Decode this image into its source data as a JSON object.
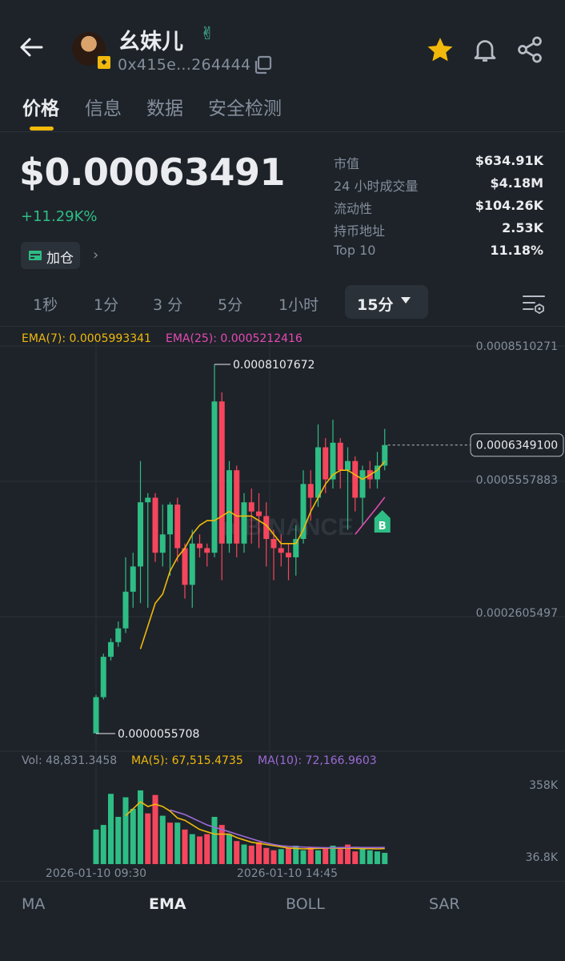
{
  "header": {
    "token_name": "幺妹儿",
    "hand_emoji": "✌",
    "address": "0x415e...264444"
  },
  "tabs": [
    {
      "label": "价格",
      "active": true
    },
    {
      "label": "信息",
      "active": false
    },
    {
      "label": "数据",
      "active": false
    },
    {
      "label": "安全检测",
      "active": false
    }
  ],
  "price": {
    "value": "$0.00063491",
    "change": "+11.29K%",
    "add_position_label": "加仓"
  },
  "stats": [
    {
      "label": "市值",
      "value": "$634.91K"
    },
    {
      "label": "24 小时成交量",
      "value": "$4.18M"
    },
    {
      "label": "流动性",
      "value": "$104.26K"
    },
    {
      "label": "持币地址",
      "value": "2.53K"
    },
    {
      "label": "Top 10",
      "value": "11.18%"
    }
  ],
  "intervals": [
    "1秒",
    "1分",
    "3 分",
    "5分",
    "1小时"
  ],
  "active_interval": "15分",
  "indicators": {
    "ema7": "EMA(7): 0.0005993341",
    "ema25": "EMA(25): 0.0005212416",
    "vol": "Vol: 48,831.3458",
    "ma5": "MA(5): 67,515.4735",
    "ma10": "MA(10): 72,166.9603"
  },
  "bottom_tabs": [
    {
      "label": "MA",
      "active": false
    },
    {
      "label": "EMA",
      "active": true
    },
    {
      "label": "BOLL",
      "active": false
    },
    {
      "label": "SAR",
      "active": false
    }
  ],
  "colors": {
    "up": "#2ebd85",
    "down": "#f6465d",
    "ema7": "#f0b90b",
    "ema25": "#e44ab5",
    "ma10": "#9c6ad6",
    "accent": "#f0b90b"
  },
  "chart_data": {
    "type": "candlestick",
    "price_axis_labels": [
      "0.0008510271",
      "0.0005557883",
      "0.0002605497"
    ],
    "current_price_label": "0.0006349100",
    "high_label": "0.0008107672",
    "low_label": "0.0000055708",
    "buy_marker": "B",
    "watermark": "BINANCE",
    "volume_axis_labels": [
      "358K",
      "36.8K"
    ],
    "time_labels": [
      "2026-01-10 09:30",
      "2026-01-10 14:45"
    ],
    "candles": [
      {
        "o": 6e-06,
        "c": 8.5e-05,
        "h": 9e-05,
        "l": 5.5708e-06
      },
      {
        "o": 8.5e-05,
        "c": 0.000173,
        "h": 0.00018,
        "l": 8e-05
      },
      {
        "o": 0.000173,
        "c": 0.000205,
        "h": 0.000213,
        "l": 0.000165
      },
      {
        "o": 0.000205,
        "c": 0.000235,
        "h": 0.00025,
        "l": 0.000195
      },
      {
        "o": 0.000235,
        "c": 0.000315,
        "h": 0.00039,
        "l": 0.000225
      },
      {
        "o": 0.000315,
        "c": 0.00037,
        "h": 0.0004,
        "l": 0.00028
      },
      {
        "o": 0.00037,
        "c": 0.00051,
        "h": 0.0006,
        "l": 0.00029
      },
      {
        "o": 0.00051,
        "c": 0.00052,
        "h": 0.00053,
        "l": 0.00028
      },
      {
        "o": 0.00052,
        "c": 0.0004,
        "h": 0.00053,
        "l": 0.00038
      },
      {
        "o": 0.0004,
        "c": 0.00044,
        "h": 0.000505,
        "l": 0.00037
      },
      {
        "o": 0.00044,
        "c": 0.000505,
        "h": 0.00051,
        "l": 0.00035
      },
      {
        "o": 0.000505,
        "c": 0.00041,
        "h": 0.00052,
        "l": 0.00038
      },
      {
        "o": 0.00041,
        "c": 0.00033,
        "h": 0.00042,
        "l": 0.0003
      },
      {
        "o": 0.00033,
        "c": 0.00042,
        "h": 0.00045,
        "l": 0.00028
      },
      {
        "o": 0.00042,
        "c": 0.00041,
        "h": 0.00044,
        "l": 0.00039
      },
      {
        "o": 0.00041,
        "c": 0.0004,
        "h": 0.00042,
        "l": 0.00037
      },
      {
        "o": 0.0004,
        "c": 0.00073,
        "h": 0.0008107672,
        "l": 0.00039
      },
      {
        "o": 0.00073,
        "c": 0.00042,
        "h": 0.00075,
        "l": 0.00034
      },
      {
        "o": 0.00042,
        "c": 0.00058,
        "h": 0.0006,
        "l": 0.0004
      },
      {
        "o": 0.00058,
        "c": 0.00042,
        "h": 0.00059,
        "l": 0.00039
      },
      {
        "o": 0.00042,
        "c": 0.00051,
        "h": 0.00053,
        "l": 0.0004
      },
      {
        "o": 0.00051,
        "c": 0.00049,
        "h": 0.00054,
        "l": 0.00042
      },
      {
        "o": 0.00049,
        "c": 0.00048,
        "h": 0.00053,
        "l": 0.00041
      },
      {
        "o": 0.00048,
        "c": 0.00043,
        "h": 0.00051,
        "l": 0.00037
      },
      {
        "o": 0.00043,
        "c": 0.00041,
        "h": 0.00045,
        "l": 0.00034
      },
      {
        "o": 0.00041,
        "c": 0.0004,
        "h": 0.00044,
        "l": 0.00037
      },
      {
        "o": 0.0004,
        "c": 0.00039,
        "h": 0.00042,
        "l": 0.00034
      },
      {
        "o": 0.00039,
        "c": 0.00043,
        "h": 0.00046,
        "l": 0.00035
      },
      {
        "o": 0.00043,
        "c": 0.00055,
        "h": 0.00058,
        "l": 0.00042
      },
      {
        "o": 0.00055,
        "c": 0.00052,
        "h": 0.00058,
        "l": 0.00047
      },
      {
        "o": 0.00052,
        "c": 0.00063,
        "h": 0.00068,
        "l": 0.0005
      },
      {
        "o": 0.00063,
        "c": 0.00056,
        "h": 0.00065,
        "l": 0.00053
      },
      {
        "o": 0.00056,
        "c": 0.00064,
        "h": 0.00069,
        "l": 0.00054
      },
      {
        "o": 0.00064,
        "c": 0.00058,
        "h": 0.00065,
        "l": 0.00054
      },
      {
        "o": 0.00058,
        "c": 0.0006,
        "h": 0.00063,
        "l": 0.00045
      },
      {
        "o": 0.0006,
        "c": 0.00052,
        "h": 0.00061,
        "l": 0.00049
      },
      {
        "o": 0.00052,
        "c": 0.00058,
        "h": 0.00059,
        "l": 0.00046
      },
      {
        "o": 0.00058,
        "c": 0.00056,
        "h": 0.0006,
        "l": 0.00054
      },
      {
        "o": 0.00056,
        "c": 0.00059,
        "h": 0.00062,
        "l": 0.00054
      },
      {
        "o": 0.00059,
        "c": 0.00063491,
        "h": 0.00067,
        "l": 0.00058
      }
    ],
    "ema7": [
      null,
      null,
      null,
      null,
      null,
      null,
      0.00019,
      0.00024,
      0.00029,
      0.00031,
      0.00036,
      0.00039,
      0.00041,
      0.00044,
      0.00046,
      0.00047,
      0.00047,
      0.00048,
      0.00049,
      0.00048,
      0.00048,
      0.00048,
      0.00047,
      0.00046,
      0.00044,
      0.00042,
      0.00042,
      0.00042,
      0.00045,
      0.00049,
      0.00052,
      0.00055,
      0.00057,
      0.00058,
      0.00058,
      0.00057,
      0.00056,
      0.00057,
      0.00058,
      0.0005993341
    ],
    "ema25": [
      null,
      null,
      null,
      null,
      null,
      null,
      null,
      null,
      null,
      null,
      null,
      null,
      null,
      null,
      null,
      null,
      null,
      null,
      null,
      null,
      null,
      null,
      null,
      null,
      null,
      null,
      null,
      null,
      null,
      null,
      null,
      null,
      null,
      null,
      null,
      0.00044,
      0.00046,
      0.00048,
      0.0005,
      0.0005212416
    ],
    "volumes": [
      {
        "v": 150000,
        "up": true
      },
      {
        "v": 170000,
        "up": true
      },
      {
        "v": 305000,
        "up": true
      },
      {
        "v": 205000,
        "up": true
      },
      {
        "v": 290000,
        "up": true
      },
      {
        "v": 240000,
        "up": true
      },
      {
        "v": 320000,
        "up": true
      },
      {
        "v": 220000,
        "up": false
      },
      {
        "v": 300000,
        "up": false
      },
      {
        "v": 210000,
        "up": true
      },
      {
        "v": 180000,
        "up": false
      },
      {
        "v": 180000,
        "up": true
      },
      {
        "v": 150000,
        "up": false
      },
      {
        "v": 130000,
        "up": true
      },
      {
        "v": 120000,
        "up": false
      },
      {
        "v": 130000,
        "up": false
      },
      {
        "v": 205000,
        "up": true
      },
      {
        "v": 170000,
        "up": false
      },
      {
        "v": 130000,
        "up": true
      },
      {
        "v": 100000,
        "up": false
      },
      {
        "v": 85000,
        "up": true
      },
      {
        "v": 80000,
        "up": false
      },
      {
        "v": 95000,
        "up": false
      },
      {
        "v": 70000,
        "up": false
      },
      {
        "v": 60000,
        "up": false
      },
      {
        "v": 65000,
        "up": true
      },
      {
        "v": 70000,
        "up": false
      },
      {
        "v": 80000,
        "up": true
      },
      {
        "v": 60000,
        "up": true
      },
      {
        "v": 75000,
        "up": false
      },
      {
        "v": 60000,
        "up": true
      },
      {
        "v": 70000,
        "up": false
      },
      {
        "v": 80000,
        "up": true
      },
      {
        "v": 65000,
        "up": false
      },
      {
        "v": 85000,
        "up": false
      },
      {
        "v": 55000,
        "up": false
      },
      {
        "v": 65000,
        "up": true
      },
      {
        "v": 60000,
        "up": true
      },
      {
        "v": 55000,
        "up": true
      },
      {
        "v": 48831,
        "up": true
      }
    ],
    "ma5": [
      null,
      null,
      null,
      null,
      210000,
      240000,
      270000,
      250000,
      260000,
      250000,
      230000,
      200000,
      190000,
      170000,
      150000,
      140000,
      130000,
      130000,
      130000,
      115000,
      105000,
      95000,
      90000,
      85000,
      80000,
      75000,
      70000,
      68000,
      66000,
      67000,
      68000,
      69000,
      70000,
      68000,
      70000,
      68000,
      67000,
      67000,
      66000,
      67515
    ],
    "ma10": [
      null,
      null,
      null,
      null,
      null,
      null,
      null,
      null,
      null,
      null,
      235000,
      225000,
      215000,
      200000,
      185000,
      170000,
      160000,
      150000,
      140000,
      130000,
      120000,
      110000,
      100000,
      92000,
      85000,
      80000,
      77000,
      75000,
      74000,
      73000,
      72000,
      71000,
      71000,
      72000,
      72000,
      73000,
      72000,
      72000,
      72000,
      72167
    ],
    "y_range": [
      5.5708e-06,
      0.0008510271
    ],
    "vol_max": 358000
  }
}
